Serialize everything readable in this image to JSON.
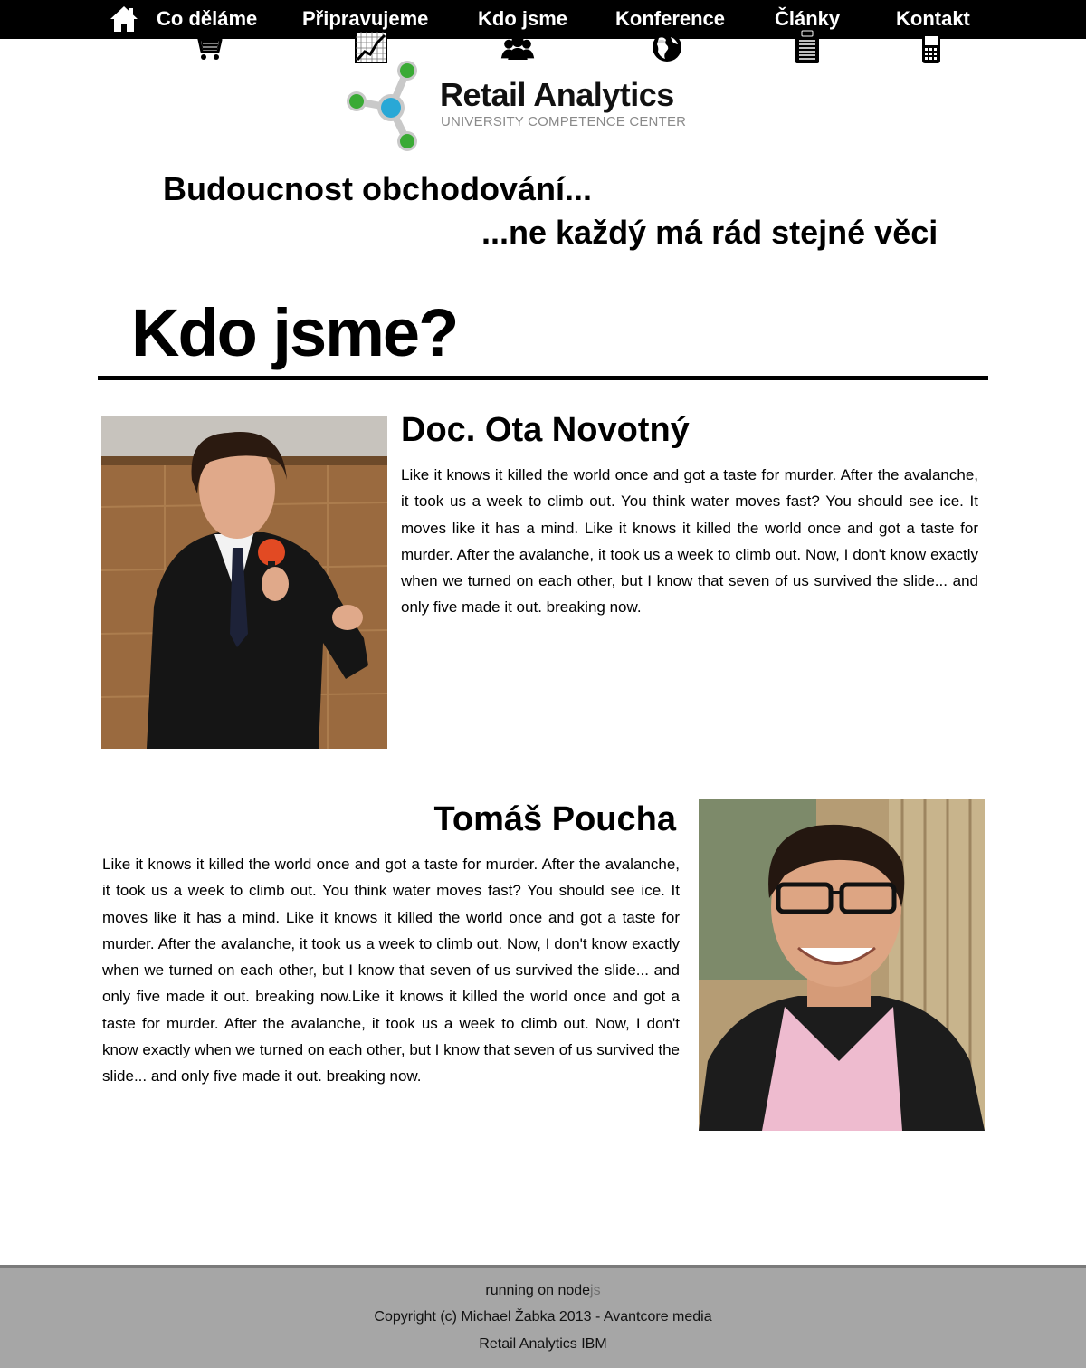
{
  "nav": {
    "home_icon": "home-icon",
    "items": [
      {
        "label": "Co děláme",
        "icon": "shopping-cart-icon"
      },
      {
        "label": "Připravujeme",
        "icon": "line-chart-icon"
      },
      {
        "label": "Kdo jsme",
        "icon": "people-icon"
      },
      {
        "label": "Konference",
        "icon": "globe-icon"
      },
      {
        "label": "Články",
        "icon": "clipboard-icon"
      },
      {
        "label": "Kontakt",
        "icon": "mobile-phone-icon"
      }
    ]
  },
  "logo": {
    "title": "Retail Analytics",
    "subtitle": "UNIVERSITY COMPETENCE CENTER",
    "colors": {
      "green": "#3aaa35",
      "blue": "#29a8d6",
      "gray": "#c9c9c9"
    }
  },
  "tagline": {
    "line1": "Budoucnost obchodování...",
    "line2": "...ne každý má rád stejné věci"
  },
  "page": {
    "title": "Kdo jsme?"
  },
  "people": [
    {
      "name": "Doc. Ota Novotný",
      "bio": "Like it knows it killed the world once and got a taste for murder. After the avalanche, it took us a week to climb out. You think water moves fast? You should see ice. It moves like it has a mind. Like it knows it killed the world once and got a taste for murder. After the avalanche, it took us a week to climb out. Now, I don't know exactly when we turned on each other, but I know that seven of us survived the slide... and only five made it out. breaking now."
    },
    {
      "name": "Tomáš Poucha",
      "bio": "Like it knows it killed the world once and got a taste for murder. After the avalanche, it took us a week to climb out. You think water moves fast? You should see ice. It moves like it has a mind. Like it knows it killed the world once and got a taste for murder. After the avalanche, it took us a week to climb out. Now, I don't know exactly when we turned on each other, but I know that seven of us survived the slide... and only five made it out. breaking now.Like it knows it killed the world once and got a taste for murder. After the avalanche, it took us a week to climb out. Now, I don't know exactly when we turned on each other, but I know that seven of us survived the slide... and only five made it out. breaking now."
    }
  ],
  "footer": {
    "running_prefix": "running on node",
    "running_suffix": "js",
    "copyright": "Copyright (c) Michael Žabka 2013 - Avantcore media",
    "ibm": "Retail Analytics IBM"
  }
}
